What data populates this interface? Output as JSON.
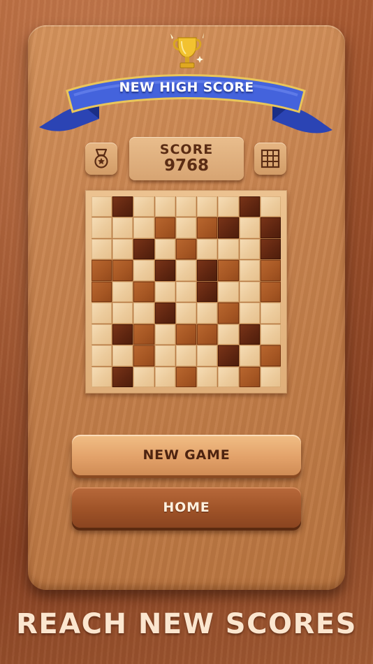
{
  "banner": {
    "text": "NEW HIGH SCORE"
  },
  "score": {
    "label": "SCORE",
    "value": "9768"
  },
  "icons": {
    "medal": "medal-icon",
    "grid": "grid-icon",
    "trophy": "trophy-icon"
  },
  "board_grid": [
    [
      "light",
      "dark",
      "light",
      "light",
      "light",
      "light",
      "light",
      "dark",
      "light"
    ],
    [
      "light",
      "light",
      "light",
      "mid",
      "light",
      "mid",
      "dark",
      "light",
      "dark"
    ],
    [
      "light",
      "light",
      "dark",
      "light",
      "mid",
      "light",
      "light",
      "light",
      "dark"
    ],
    [
      "mid",
      "mid",
      "light",
      "dark",
      "light",
      "dark",
      "mid",
      "light",
      "mid"
    ],
    [
      "mid",
      "light",
      "mid",
      "light",
      "light",
      "dark",
      "light",
      "light",
      "mid"
    ],
    [
      "light",
      "light",
      "light",
      "dark",
      "light",
      "light",
      "mid",
      "light",
      "light"
    ],
    [
      "light",
      "dark",
      "mid",
      "light",
      "mid",
      "mid",
      "light",
      "dark",
      "light"
    ],
    [
      "light",
      "light",
      "mid",
      "light",
      "light",
      "light",
      "dark",
      "light",
      "mid"
    ],
    [
      "light",
      "dark",
      "light",
      "light",
      "mid",
      "light",
      "light",
      "mid",
      "light"
    ]
  ],
  "buttons": {
    "new_game": "NEW GAME",
    "home": "HOME"
  },
  "tagline": "REACH NEW SCORES",
  "colors": {
    "ribbon": "#3f5fd6",
    "gold": "#f2c230",
    "wood_light": "#f0d3a8",
    "wood_dark": "#5e2510"
  }
}
